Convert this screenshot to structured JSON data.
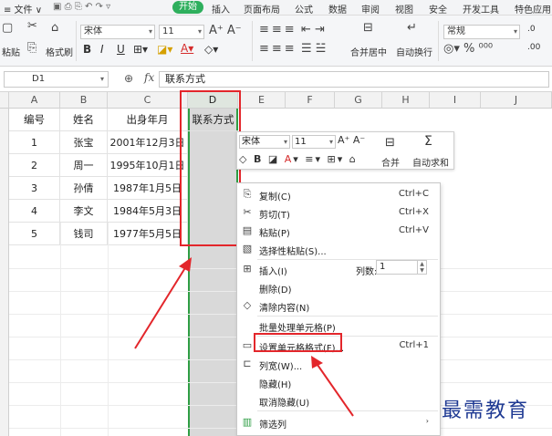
{
  "menu": {
    "file": "≡ 文件 ∨",
    "items": [
      "开始",
      "插入",
      "页面布局",
      "公式",
      "数据",
      "审阅",
      "视图",
      "安全",
      "开发工具",
      "特色应用"
    ]
  },
  "ribbon": {
    "paste_label": "粘贴",
    "format_painter_label": "格式刷",
    "font_name": "宋体",
    "font_size": "11",
    "merge_label": "合并居中",
    "wrap_label": "自动换行",
    "number_format": "常规",
    "cut_label": "剪切",
    "copy_label": "复制"
  },
  "formula_bar": {
    "cell_ref": "D1",
    "fx": "fx",
    "content": "联系方式"
  },
  "columns": [
    "A",
    "B",
    "C",
    "D",
    "E",
    "F",
    "G",
    "H",
    "I",
    "J"
  ],
  "table": {
    "headers": [
      "编号",
      "姓名",
      "出身年月",
      "联系方式"
    ],
    "rows": [
      [
        "1",
        "张宝",
        "2001年12月3日"
      ],
      [
        "2",
        "周一",
        "1995年10月1日"
      ],
      [
        "3",
        "孙倩",
        "1987年1月5日"
      ],
      [
        "4",
        "李文",
        "1984年5月3日"
      ],
      [
        "5",
        "钱司",
        "1977年5月5日"
      ]
    ]
  },
  "mini_toolbar": {
    "font_name": "宋体",
    "font_size": "11",
    "merge_label": "合并",
    "autosum_label": "自动求和"
  },
  "context_menu": {
    "copy": "复制(C)",
    "copy_shortcut": "Ctrl+C",
    "cut": "剪切(T)",
    "cut_shortcut": "Ctrl+X",
    "paste": "粘贴(P)",
    "paste_shortcut": "Ctrl+V",
    "paste_special": "选择性粘贴(S)...",
    "insert": "插入(I)",
    "col_count_label": "列数:",
    "col_count": "1",
    "delete": "删除(D)",
    "clear": "清除内容(N)",
    "batch": "批量处理单元格(P)",
    "format_cells": "设置单元格格式(F)...",
    "format_cells_shortcut": "Ctrl+1",
    "col_width": "列宽(W)...",
    "hide": "隐藏(H)",
    "unhide": "取消隐藏(U)",
    "filter": "筛选列"
  },
  "watermark": "最需教育",
  "colors": {
    "accent": "#2eaf5d",
    "highlight": "#e3262b",
    "watermark": "#1f3a93"
  }
}
